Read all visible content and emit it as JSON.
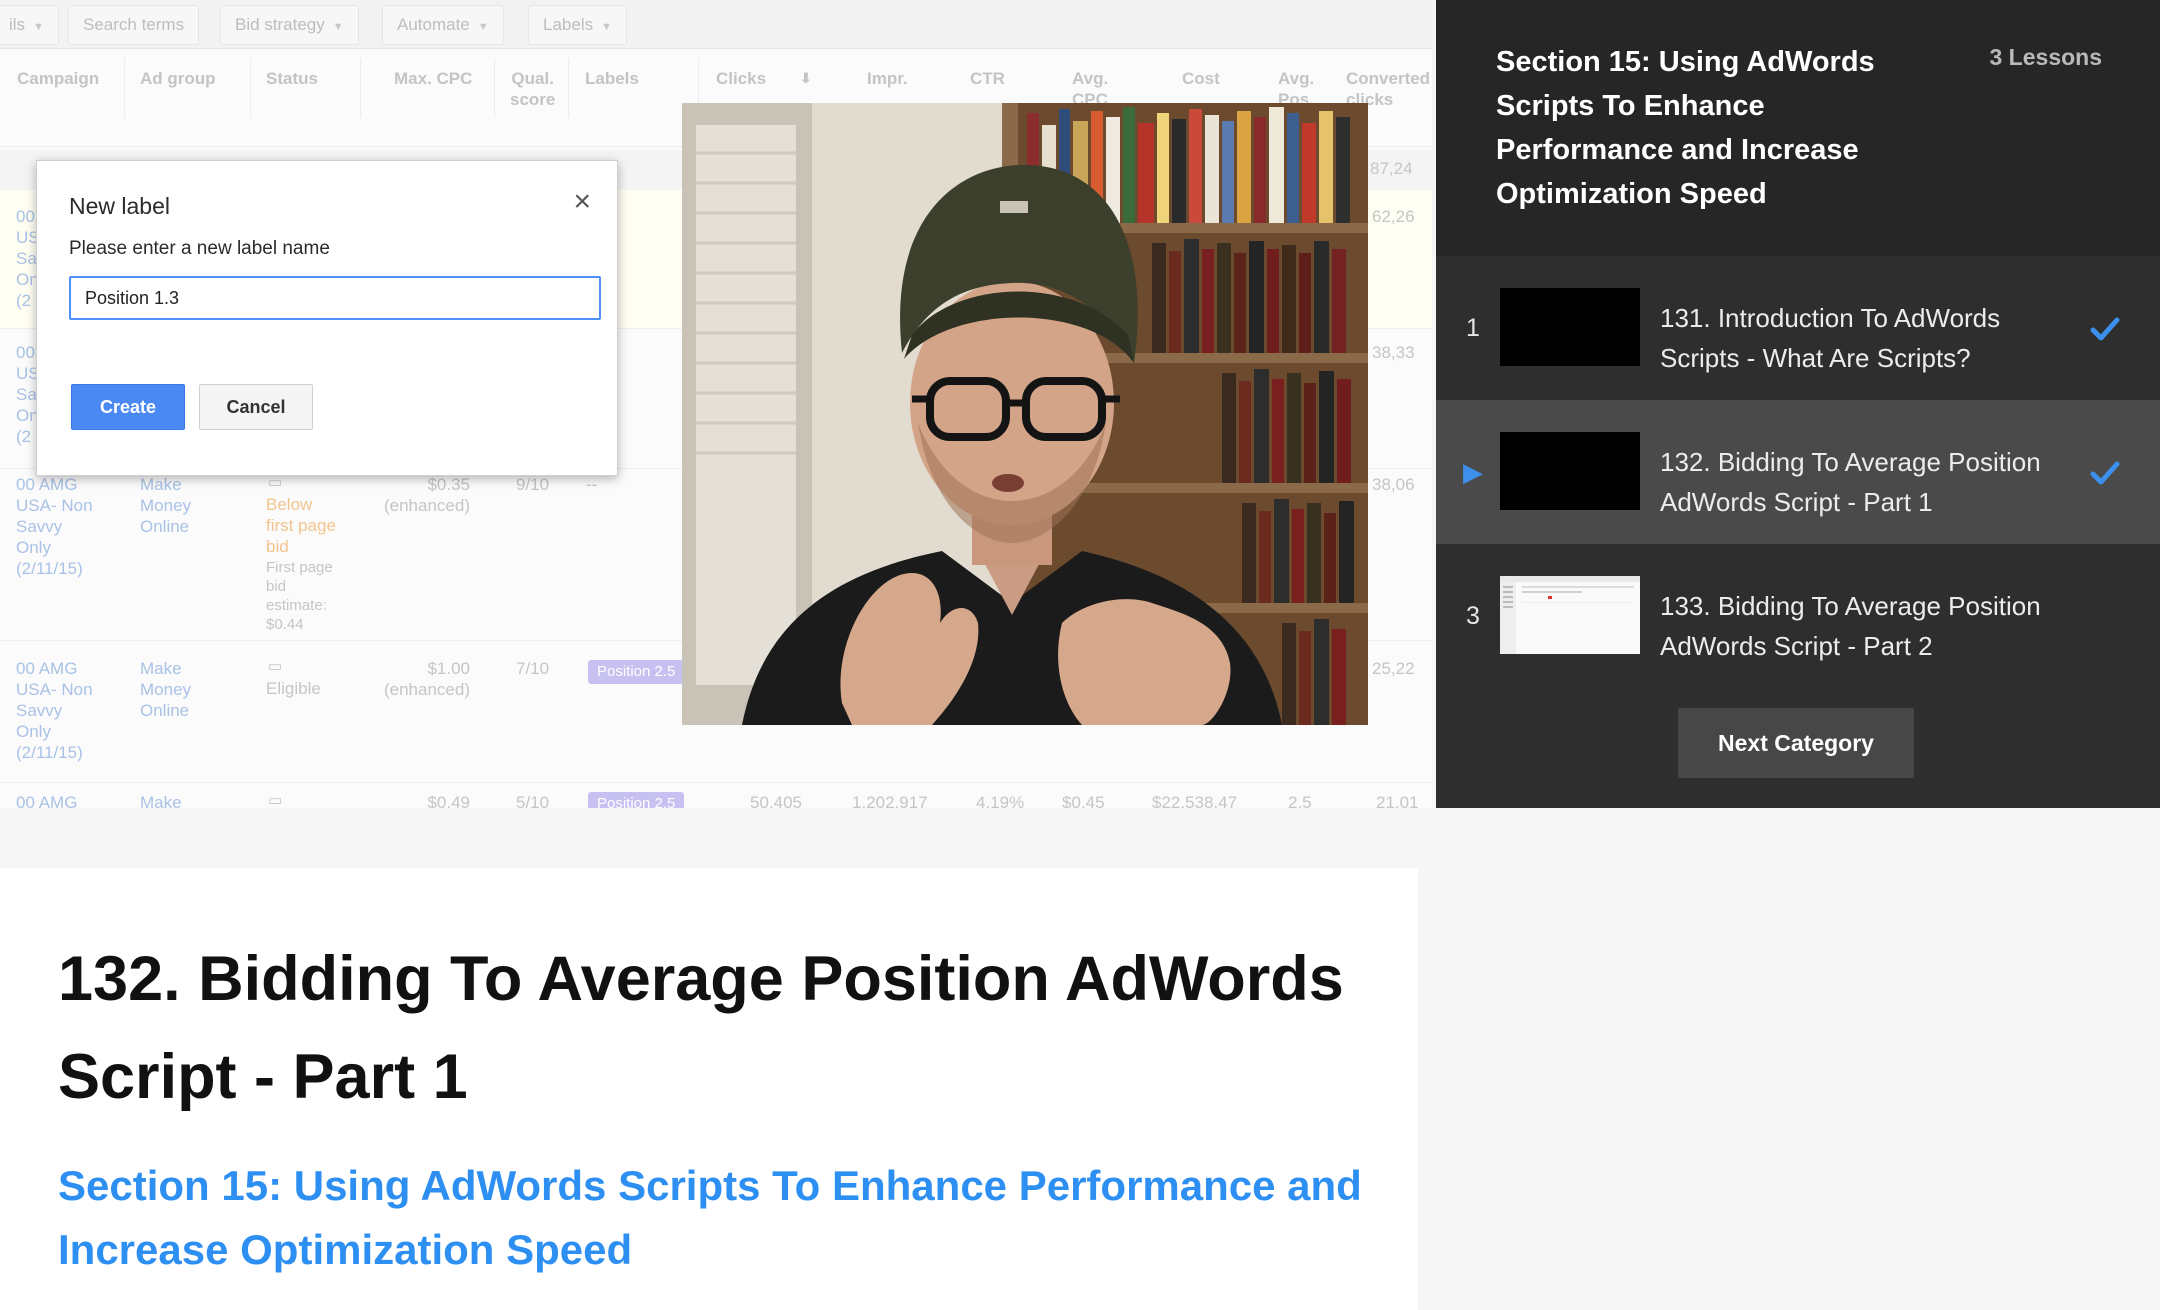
{
  "video": {
    "toolbar": {
      "partial": "ils",
      "search_terms": "Search terms",
      "bid_strategy": "Bid strategy",
      "automate": "Automate",
      "labels": "Labels"
    },
    "columns": {
      "campaign": "Campaign",
      "ad_group": "Ad group",
      "status": "Status",
      "max_cpc": "Max. CPC",
      "qual_score": "Qual.\nscore",
      "labels": "Labels",
      "clicks": "Clicks",
      "impr": "Impr.",
      "ctr": "CTR",
      "avg_cpc": "Avg.\nCPC",
      "cost": "Cost",
      "avg_pos": "Avg.\nPos.",
      "converted_clicks": "Converted\nclicks"
    },
    "rows": [
      {
        "campaign": "00 AMG\nUSA- Non\nSavvy\nOnly\n(2/11/15)",
        "ad_group": "Make\nMoney\nOnline",
        "status_warning": "Below\nfirst page\nbid",
        "status_note": "First page\nbid\nestimate:\n$0.44",
        "max_cpc": "$0.35\n(enhanced)",
        "qual_score": "9/10",
        "labels": "--",
        "converted_clicks": "38,06"
      },
      {
        "campaign": "00 AMG\nUSA- Non\nSavvy\nOnly\n(2/11/15)",
        "ad_group": "Make\nMoney\nOnline",
        "status": "Eligible",
        "max_cpc": "$1.00\n(enhanced)",
        "qual_score": "7/10",
        "label_pill": "Position 2.5",
        "converted_clicks": "25,22"
      },
      {
        "campaign": "00 AMG",
        "ad_group": "Make",
        "max_cpc": "$0.49",
        "qual_score": "5/10",
        "label_pill": "Position 2.5",
        "clicks": "50,405",
        "impr": "1,202,917",
        "ctr": "4.19%",
        "avg_cpc": "$0.45",
        "cost": "$22,538.47",
        "avg_pos": "2.5",
        "converted_clicks": "21,01"
      }
    ],
    "partial_rows": {
      "total": "87,24",
      "row_a": "62,26",
      "row_b": "38,33",
      "hidden_campaign_a": "00\nUS\nSa\nOn\n(2",
      "hidden_campaign_b": "00\nUS\nSa\nOn\n(2"
    },
    "dialog": {
      "title": "New label",
      "prompt": "Please enter a new label name",
      "input_value": "Position 1.3",
      "create": "Create",
      "cancel": "Cancel"
    }
  },
  "sidebar": {
    "section_title": "Section 15: Using AdWords Scripts To Enhance Performance and Increase Optimization Speed",
    "lesson_count": "3 Lessons",
    "lessons": [
      {
        "number": "1",
        "title": "131. Introduction To AdWords Scripts - What Are Scripts?",
        "completed": true,
        "active": false
      },
      {
        "number": "",
        "title": "132. Bidding To Average Position AdWords Script - Part 1",
        "completed": true,
        "active": true
      },
      {
        "number": "3",
        "title": "133. Bidding To Average Position AdWords Script - Part 2",
        "completed": false,
        "active": false
      }
    ],
    "next_button": "Next Category"
  },
  "info": {
    "lecture_title": "132. Bidding To Average Position AdWords Script - Part 1",
    "section_link": "Section 15: Using AdWords Scripts To Enhance Performance and Increase Optimization Speed"
  },
  "colors": {
    "accent_blue": "#2e8ff2",
    "sidebar_bg": "#2e2e2e",
    "sidebar_header_bg": "#262626",
    "active_lesson_bg": "#4a4a4a",
    "dialog_button_blue": "#4a89f3",
    "label_pill": "#c6c1f0"
  },
  "icons": {
    "play": "play-icon",
    "check": "check-icon",
    "close": "close-icon",
    "help": "help-icon",
    "dropdown": "caret-down-icon",
    "sort": "sort-down-icon"
  }
}
